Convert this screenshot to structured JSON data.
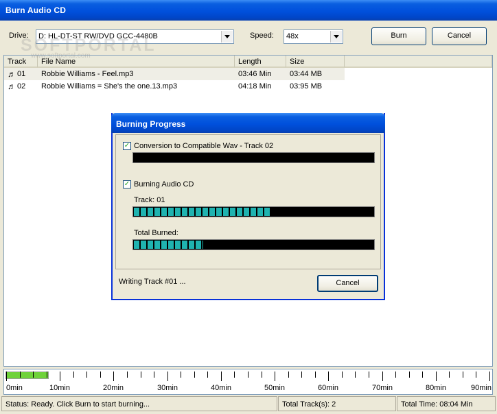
{
  "window": {
    "title": "Burn Audio CD"
  },
  "toolbar": {
    "drive_label": "Drive:",
    "drive_value": "D: HL-DT-ST RW/DVD GCC-4480B",
    "speed_label": "Speed:",
    "speed_value": "48x",
    "burn_label": "Burn",
    "cancel_label": "Cancel"
  },
  "watermark": {
    "text": "SOFTPORTAL",
    "sub": "www.softportal.com"
  },
  "tracklist": {
    "columns": [
      "Track",
      "File Name",
      "Length",
      "Size"
    ],
    "rows": [
      {
        "track": "01",
        "file": "Robbie Williams - Feel.mp3",
        "length": "03:46 Min",
        "size": "03:44 MB"
      },
      {
        "track": "02",
        "file": "Robbie Williams = She's the one.13.mp3",
        "length": "04:18 Min",
        "size": "03:95 MB"
      }
    ]
  },
  "dialog": {
    "title": "Burning Progress",
    "conversion_label": "Conversion to Compatible Wav - Track 02",
    "conversion_progress": 0,
    "burning_label": "Burning Audio CD",
    "track_label": "Track: 01",
    "track_progress": 0.57,
    "total_label": "Total Burned:",
    "total_progress": 0.29,
    "status": "Writing Track #01 ...",
    "cancel_label": "Cancel"
  },
  "ruler": {
    "labels": [
      "0min",
      "10min",
      "20min",
      "30min",
      "40min",
      "50min",
      "60min",
      "70min",
      "80min",
      "90min"
    ],
    "used_fraction": 0.09
  },
  "statusbar": {
    "status": "Status: Ready. Click Burn to start burning...",
    "total_tracks": "Total Track(s): 2",
    "total_time": "Total Time: 08:04 Min"
  },
  "colors": {
    "title_blue": "#0050dc",
    "progress_teal": "#1fb3b0",
    "ruler_green": "#6fd23a"
  }
}
